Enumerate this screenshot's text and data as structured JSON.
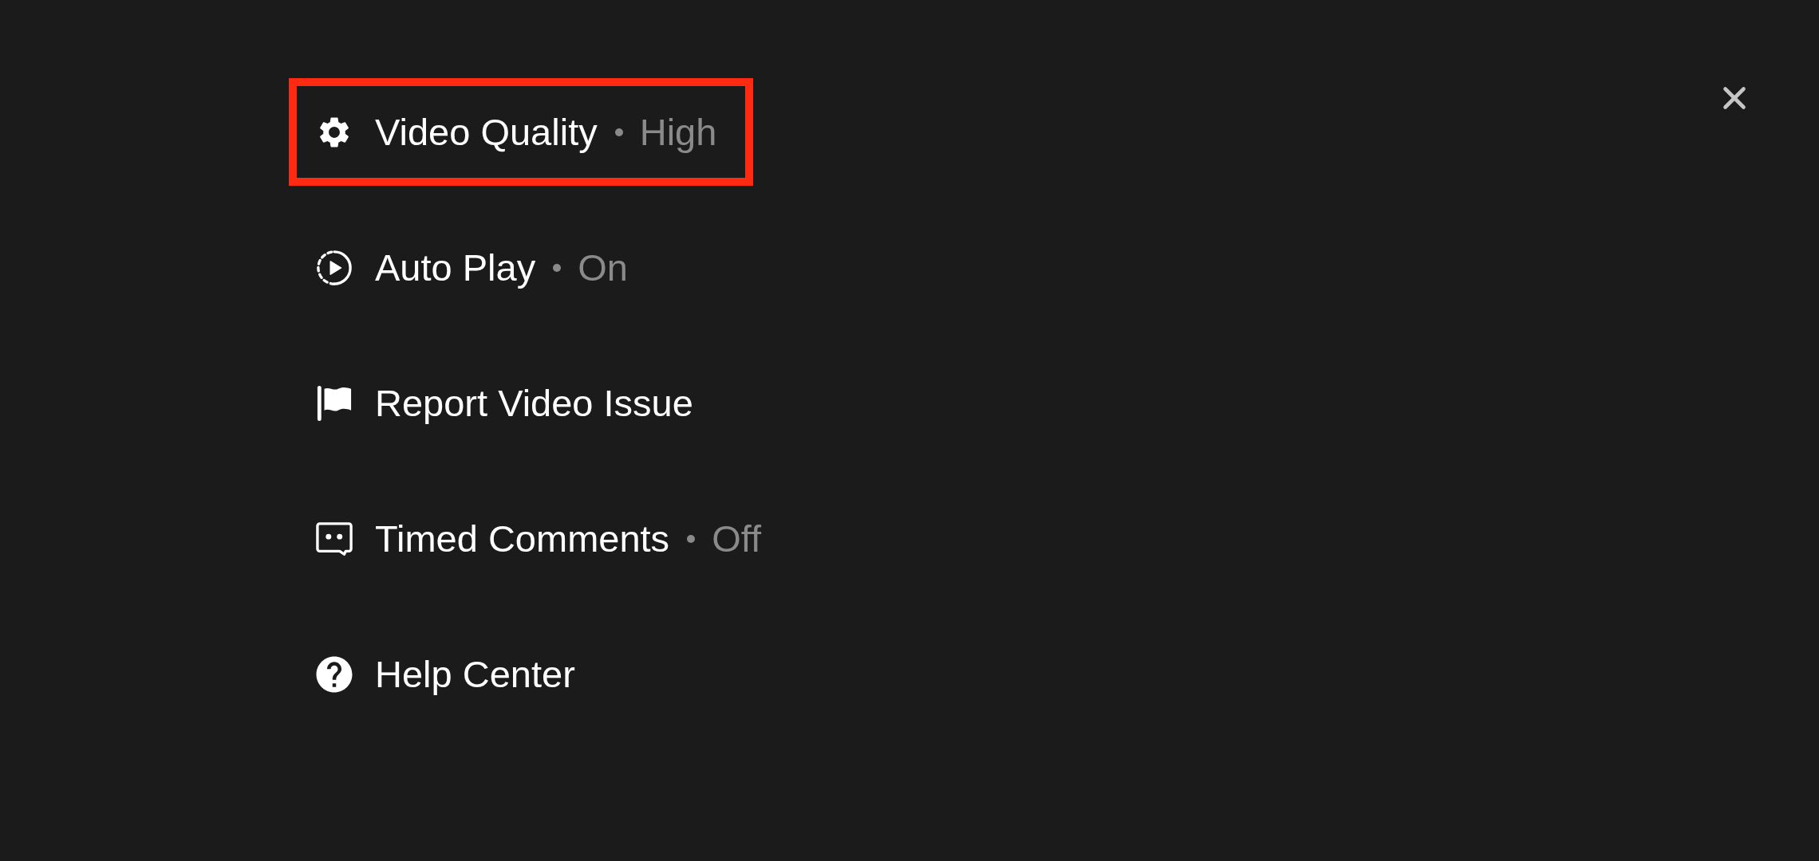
{
  "menu": {
    "items": [
      {
        "label": "Video Quality",
        "value": "High",
        "selected": true
      },
      {
        "label": "Auto Play",
        "value": "On",
        "selected": false
      },
      {
        "label": "Report Video Issue",
        "selected": false
      },
      {
        "label": "Timed Comments",
        "value": "Off",
        "selected": false
      },
      {
        "label": "Help Center",
        "selected": false
      }
    ]
  }
}
